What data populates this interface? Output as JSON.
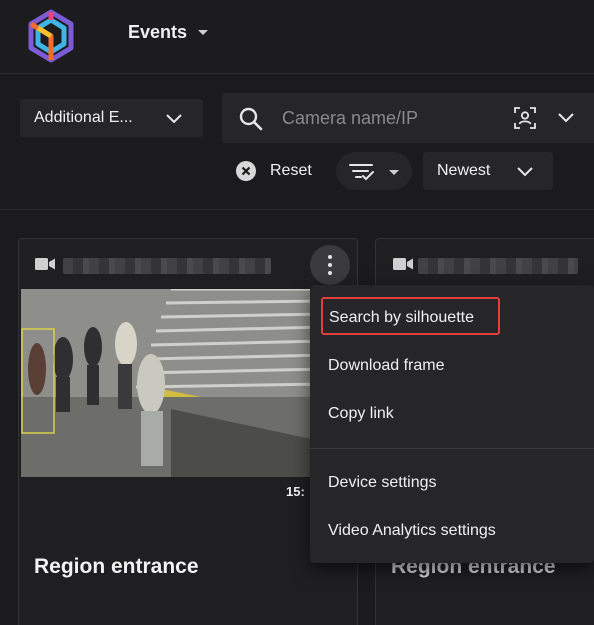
{
  "header": {
    "title": "Events",
    "colors": {
      "logo": [
        "#f26b2a",
        "#e8457a",
        "#7b5cd6",
        "#3fb4e6",
        "#f4c12e"
      ]
    }
  },
  "filters": {
    "type_select": "Additional E...",
    "search_placeholder": "Camera name/IP",
    "reset_label": "Reset",
    "order_select": "Newest"
  },
  "cards": [
    {
      "time": "15:",
      "title": "Region entrance"
    },
    {
      "title": "Region entrance"
    }
  ],
  "context_menu": {
    "items": [
      {
        "label": "Search by silhouette",
        "highlighted": true
      },
      {
        "label": "Download frame"
      },
      {
        "label": "Copy link"
      },
      {
        "label": "Device settings"
      },
      {
        "label": "Video Analytics settings"
      }
    ],
    "highlight_color": "#e0403a"
  }
}
